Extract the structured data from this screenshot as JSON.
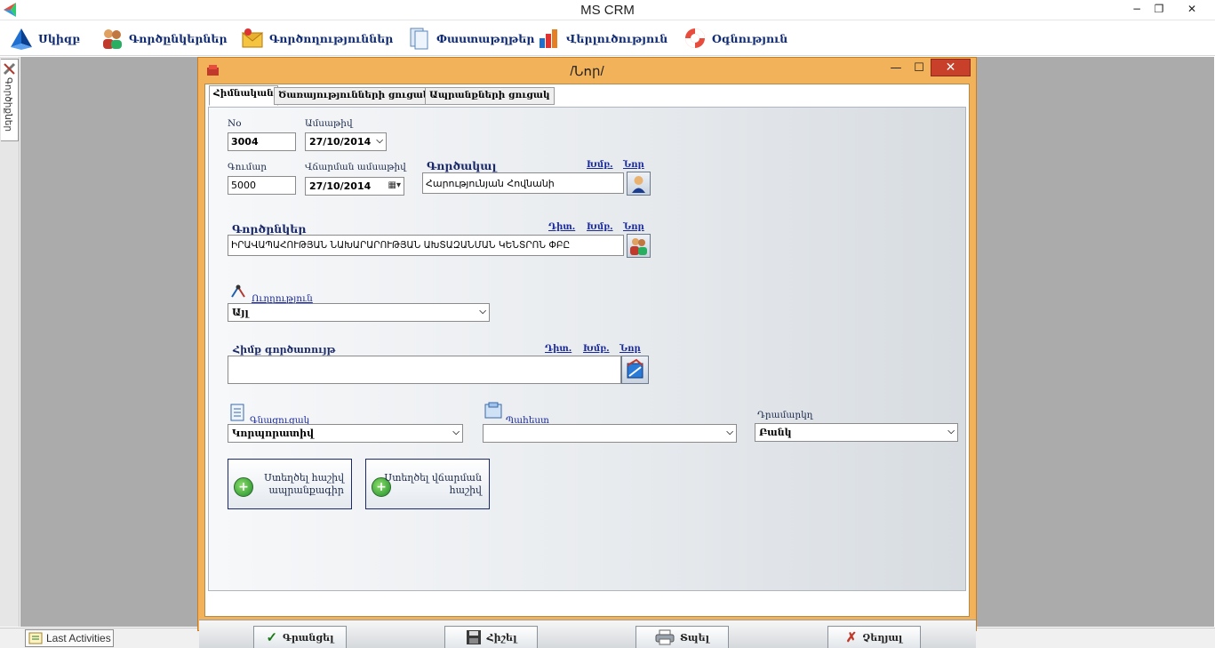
{
  "app": {
    "title": "MS CRM",
    "min_glyph": "−",
    "restore_glyph": "❐",
    "close_glyph": "✕"
  },
  "menu": {
    "items": [
      {
        "label": "Սկիզբ",
        "icon": "home-pyramid-icon"
      },
      {
        "label": "Գործընկերներ",
        "icon": "partners-icon"
      },
      {
        "label": "Գործողություններ",
        "icon": "actions-icon"
      },
      {
        "label": "Փաստաթղթեր",
        "icon": "documents-icon"
      },
      {
        "label": "Վերլուծություն",
        "icon": "analysis-icon"
      },
      {
        "label": "Օգնություն",
        "icon": "help-lifebuoy-icon"
      }
    ]
  },
  "side_tab": {
    "label": "Գործիքներ"
  },
  "status": {
    "last_activities": "Last Activities"
  },
  "window": {
    "title": "/Նոր/",
    "min_glyph": "—",
    "max_glyph": "☐",
    "close_glyph": "✕",
    "tabs": [
      "Հիմնական",
      "Ծառայությունների ցուցակ",
      "Ապրանքների ցուցակ"
    ],
    "form": {
      "no_label": "No",
      "no_value": "3004",
      "date_label": "Ամսաթիվ",
      "date_value": "27/10/2014",
      "amount_label": "Գումար",
      "amount_value": "5000",
      "pay_date_label": "Վճարման ամսաթիվ",
      "pay_date_value": "27/10/2014",
      "agent_label": "Գործակալ",
      "agent_edit": "Խմբ.",
      "agent_new": "Նոր",
      "agent_value": "Հարությունյան Հովնանի",
      "partners_label": "Գործընկեր",
      "partners_view": "Դիտ.",
      "partners_edit": "Խմբ.",
      "partners_new": "Նոր",
      "partners_value": "ԻՐԱՎԱՊԱՀՈՒԹՅԱՆ ՆԱԽԱՐԱՐՈՒԹՅԱՆ ԱԽՏԱԶԱՆՄԱՆ ԿԵՆՏՐՈՆ ՓԲԸ",
      "direction_label": "Ուղղություն",
      "direction_value": "Այլ",
      "basis_label": "Հիմք գործառույթ",
      "basis_view": "Դիտ.",
      "basis_edit": "Խմբ.",
      "basis_new": "Նոր",
      "basis_value": "",
      "pricelist_label": "Գնացուցակ",
      "pricelist_value": "Կորպորատիվ",
      "warehouse_label": "Պահեստ",
      "warehouse_value": "",
      "payment_label": "Դրամարկղ",
      "payment_value": "Բանկ",
      "btn_add_invoice": "Ստեղծել հաշիվ\nապրանքագիր",
      "btn_add_pay_invoice": "Ստեղծել վճարման\nհաշիվ"
    },
    "buttons": {
      "confirm": "Գրանցել",
      "save": "Հիշել",
      "print": "Տպել",
      "cancel": "Չեղյալ"
    }
  },
  "colors": {
    "accent_orange": "#f2b25a",
    "close_red": "#c8402a",
    "link_blue": "#1a2a9a"
  }
}
